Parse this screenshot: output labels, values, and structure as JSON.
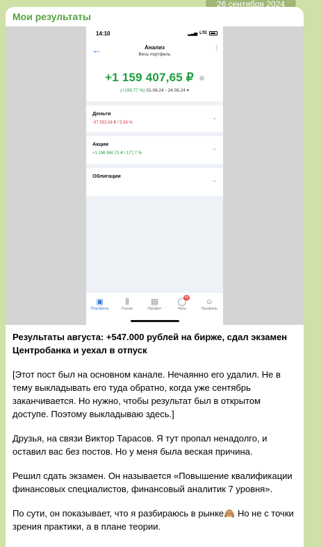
{
  "date": "26 сентября 2024",
  "channel": "Мои результаты",
  "phone": {
    "time": "14:10",
    "network": "LTE",
    "nav_title": "Анализ",
    "nav_subtitle": "Весь портфель",
    "total": "+1 159 407,65 ₽",
    "total_pct": "(+199,77 %)",
    "total_period": "01.08.24 - 24.08.24 ▾",
    "rows": [
      {
        "title": "Деньги",
        "value": "-37 553,08 ₽ / 5,58 %"
      },
      {
        "title": "Акции",
        "value": "+1 196 960,73 ₽ / 177,7 %"
      },
      {
        "title": "Облигации",
        "value": ""
      }
    ],
    "tabs": [
      {
        "label": "Портфель",
        "icon": "briefcase-icon"
      },
      {
        "label": "Рынки",
        "icon": "candlestick-icon"
      },
      {
        "label": "Профит",
        "icon": "profit-icon"
      },
      {
        "label": "Чаты",
        "icon": "chat-icon",
        "badge": "55"
      },
      {
        "label": "Профиль",
        "icon": "profile-icon"
      }
    ]
  },
  "post": {
    "headline": "Результаты августа: +547.000 рублей на бирже, сдал экзамен Центробанка и уехал в отпуск",
    "p1": "[Этот пост был на основном канале. Нечаянно его удалил. Не в тему выкладывать его туда обратно, когда уже сентябрь заканчивается. Но нужно, чтобы результат был в открытом доступе. Поэтому выкладываю здесь.]",
    "p2": "Друзья, на связи Виктор Тарасов. Я тут пропал ненадолго, и оставил вас без постов. Но у меня была веская причина.",
    "p3": "Решил сдать экзамен. Он называется «Повышение квалификации финансовых специалистов, финансовый аналитик 7 уровня».",
    "p4": "По сути, он показывает, что я разбираюсь в рынке🙈 Но не с точки зрения практики, а в плане теории."
  }
}
